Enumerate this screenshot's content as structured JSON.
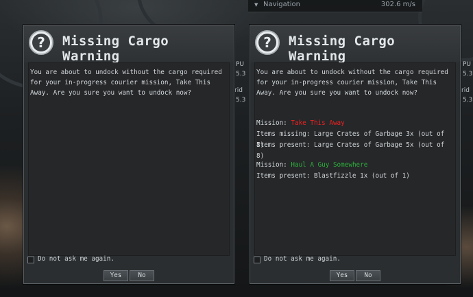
{
  "background": {
    "navigation_label": "Navigation",
    "speed": "302.6 m/s",
    "fragments": [
      "PU",
      "5.3",
      "rid",
      "5.3",
      "PU",
      "5.3",
      "rid",
      "5.3"
    ]
  },
  "dialogs": [
    {
      "title": "Missing Cargo Warning",
      "message": "You are about to undock without the cargo required for your in-progress courier mission, Take This Away. Are you sure you want to undock now?",
      "missions": [],
      "checkbox_label": "Do not ask me again.",
      "yes_label": "Yes",
      "no_label": "No"
    },
    {
      "title": "Missing Cargo Warning",
      "message": "You are about to undock without the cargo required for your in-progress courier mission, Take This Away. Are you sure you want to undock now?",
      "missions": [
        {
          "label": "Mission:",
          "name": "Take This Away",
          "name_color": "#ee2222",
          "lines": [
            "Items missing: Large Crates of Garbage 3x (out of 8)",
            "Items present: Large Crates of Garbage 5x (out of 8)"
          ]
        },
        {
          "label": "Mission:",
          "name": "Haul A Guy Somewhere",
          "name_color": "#2fae3c",
          "lines": [
            "Items present: Blastfizzle 1x (out of 1)"
          ]
        }
      ],
      "checkbox_label": "Do not ask me again.",
      "yes_label": "Yes",
      "no_label": "No"
    }
  ],
  "icons": {
    "dialog": "question-icon",
    "nav": "triangle-down-icon"
  }
}
